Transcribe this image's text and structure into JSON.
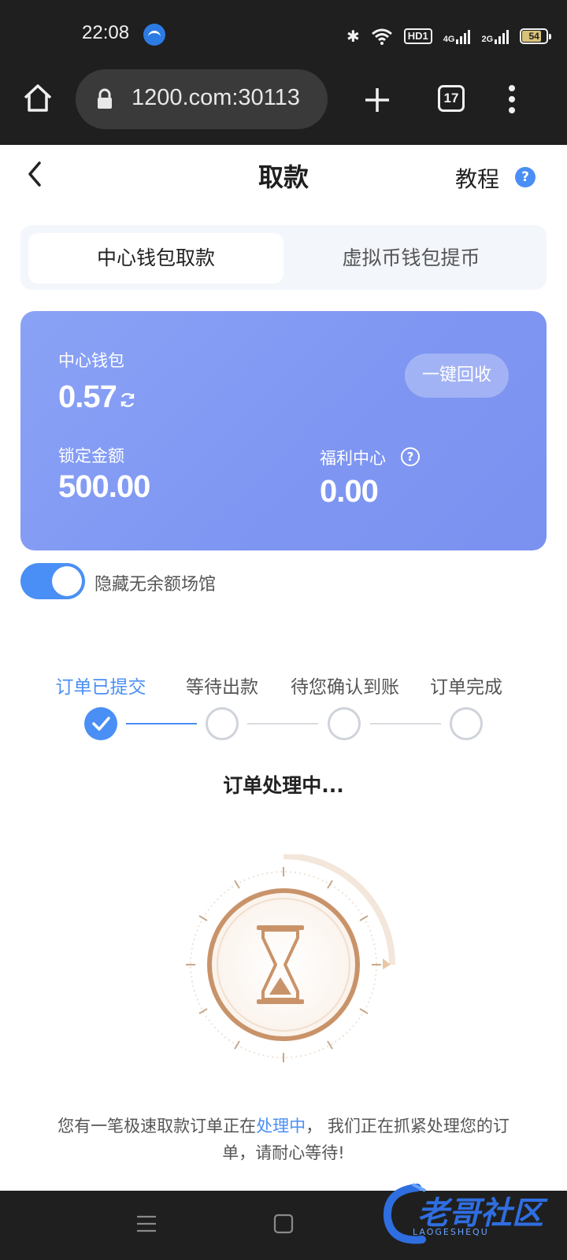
{
  "status_bar": {
    "time": "22:08",
    "hd_label": "HD1",
    "net1": "4G",
    "net2": "2G",
    "battery": "54"
  },
  "browser": {
    "url": "1200.com:30113",
    "tab_count": "17"
  },
  "header": {
    "title": "取款",
    "tutorial": "教程",
    "help_mark": "?"
  },
  "tabs": [
    {
      "label": "中心钱包取款"
    },
    {
      "label": "虚拟币钱包提币"
    }
  ],
  "wallet_card": {
    "center_wallet_label": "中心钱包",
    "center_wallet_value": "0.57",
    "recycle_button": "一键回收",
    "locked_label": "锁定金额",
    "locked_value": "500.00",
    "welfare_label": "福利中心",
    "welfare_help": "?",
    "welfare_value": "0.00"
  },
  "toggle": {
    "label": "隐藏无余额场馆",
    "on": true
  },
  "steps": [
    {
      "label": "订单已提交",
      "done": true
    },
    {
      "label": "等待出款",
      "done": false
    },
    {
      "label": "待您确认到账",
      "done": false
    },
    {
      "label": "订单完成",
      "done": false
    }
  ],
  "processing_text": "订单处理中...",
  "notice": {
    "part1": "您有一笔极速取款订单正在",
    "highlight": "处理中",
    "part2": "， 我们正在抓紧处理您的订单，请耐心等待!"
  },
  "watermark": {
    "text": "老哥社区",
    "sub": "LAOGESHEQU"
  },
  "colors": {
    "accent": "#4a8ff5",
    "card": "#7f97f2",
    "hourglass": "#c9936a"
  }
}
